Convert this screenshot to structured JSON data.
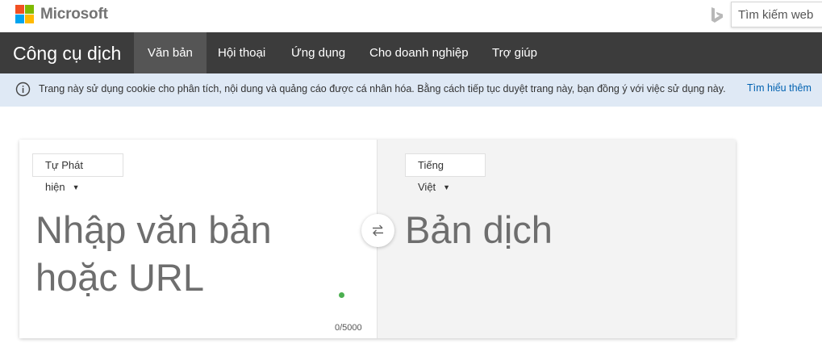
{
  "brand": {
    "name": "Microsoft",
    "colors": {
      "red": "#f25022",
      "green": "#7fba00",
      "blue": "#00a4ef",
      "yellow": "#ffb900"
    }
  },
  "search": {
    "placeholder": "Tìm kiếm web",
    "icon": "bing-icon"
  },
  "nav": {
    "title": "Công cụ dịch",
    "items": [
      {
        "label": "Văn bản",
        "active": true
      },
      {
        "label": "Hội thoại"
      },
      {
        "label": "Ứng dụng"
      },
      {
        "label": "Cho doanh nghiệp"
      },
      {
        "label": "Trợ giúp"
      }
    ]
  },
  "cookie_banner": {
    "text": "Trang này sử dụng cookie cho phân tích, nội dung và quảng cáo được cá nhân hóa. Bằng cách tiếp tục duyệt trang này, bạn đồng ý với việc sử dụng này.",
    "link": "Tìm hiểu thêm",
    "icon": "info-icon"
  },
  "translator": {
    "source_language": "Tự Phát hiện",
    "target_language": "Tiếng Việt",
    "source_placeholder_line1": "Nhập văn bản",
    "source_placeholder_line2": "hoặc URL",
    "target_placeholder": "Bản dịch",
    "char_count": "0/5000",
    "swap_icon": "swap-arrows-icon"
  }
}
